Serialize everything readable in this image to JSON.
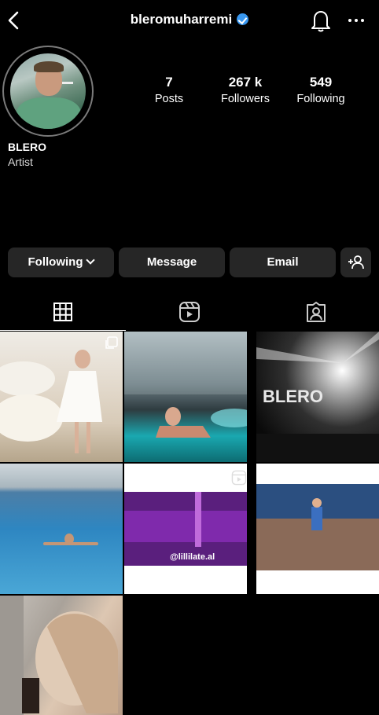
{
  "header": {
    "username": "bleromuharremi",
    "icons": {
      "back": "chevron-left-icon",
      "verified": "verified-badge-icon",
      "notifications": "bell-icon",
      "more": "more-options-icon"
    },
    "colors": {
      "verified": "#3897f0"
    }
  },
  "profile": {
    "display_name": "BLERO",
    "category": "Artist",
    "stats": [
      {
        "value": "7",
        "label": "Posts"
      },
      {
        "value": "267 k",
        "label": "Followers"
      },
      {
        "value": "549",
        "label": "Following"
      }
    ]
  },
  "actions": {
    "following": "Following",
    "message": "Message",
    "email": "Email",
    "suggested_icon": "add-person-icon"
  },
  "tabs": [
    {
      "name": "posts",
      "icon": "grid-icon",
      "selected": true
    },
    {
      "name": "reels",
      "icon": "reels-icon",
      "selected": false
    },
    {
      "name": "tagged",
      "icon": "tagged-icon",
      "selected": false
    }
  ],
  "posts": [
    {
      "id": 1,
      "overlay_icon": "carousel-icon",
      "overlay_text": ""
    },
    {
      "id": 2,
      "overlay_icon": "",
      "overlay_text": ""
    },
    {
      "id": 3,
      "overlay_icon": "",
      "overlay_text": "BLERO"
    },
    {
      "id": 4,
      "overlay_icon": "",
      "overlay_text": ""
    },
    {
      "id": 5,
      "overlay_icon": "reels-icon",
      "overlay_text": "@lillilate.al"
    },
    {
      "id": 6,
      "overlay_icon": "",
      "overlay_text": ""
    },
    {
      "id": 7,
      "overlay_icon": "",
      "overlay_text": ""
    }
  ]
}
